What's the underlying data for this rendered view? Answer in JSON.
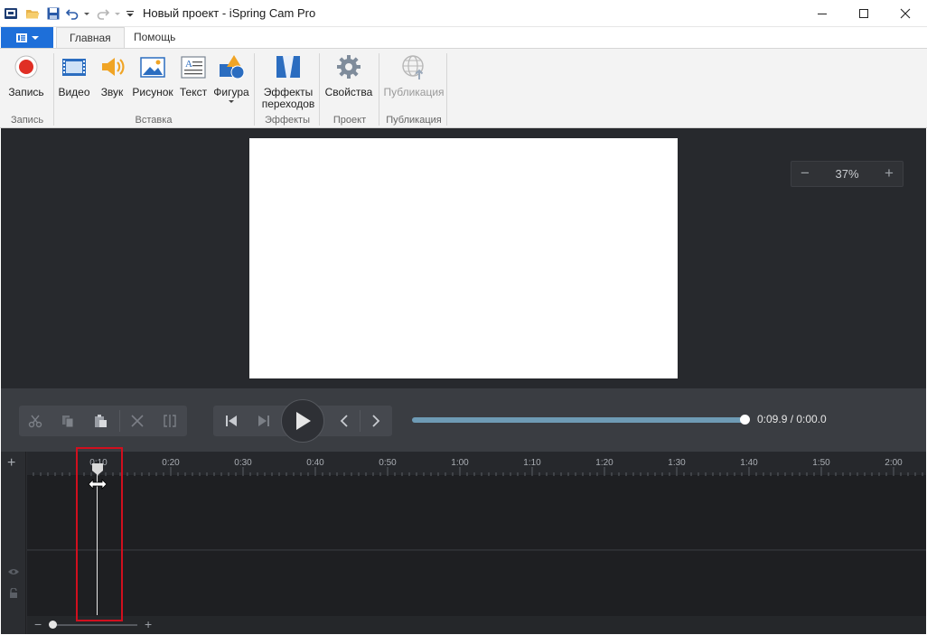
{
  "window": {
    "title": "Новый проект - iSpring Cam Pro"
  },
  "ribbon_tabs": {
    "home": "Главная",
    "help": "Помощь"
  },
  "ribbon": {
    "record": "Запись",
    "video": "Видео",
    "sound": "Звук",
    "picture": "Рисунок",
    "text": "Текст",
    "shape": "Фигура",
    "transitions_line1": "Эффекты",
    "transitions_line2": "переходов",
    "properties": "Свойства",
    "publish": "Публикация",
    "groups": {
      "record": "Запись",
      "insert": "Вставка",
      "effects": "Эффекты",
      "project": "Проект",
      "publish": "Публикация"
    }
  },
  "zoom": {
    "value": "37%",
    "minus": "−",
    "plus": "+"
  },
  "playback": {
    "time": "0:09.9 / 0:00.0",
    "progress": 1.0
  },
  "timeline": {
    "ticks": [
      "0:10",
      "0:20",
      "0:30",
      "0:40",
      "0:50",
      "1:00",
      "1:10",
      "1:20",
      "1:30",
      "1:40",
      "1:50",
      "2:00"
    ],
    "add": "+",
    "zoom_minus": "−",
    "zoom_plus": "+"
  },
  "colors": {
    "accent": "#1e6fd9",
    "progress": "#6e9bb5",
    "highlight": "#d10f1e"
  }
}
